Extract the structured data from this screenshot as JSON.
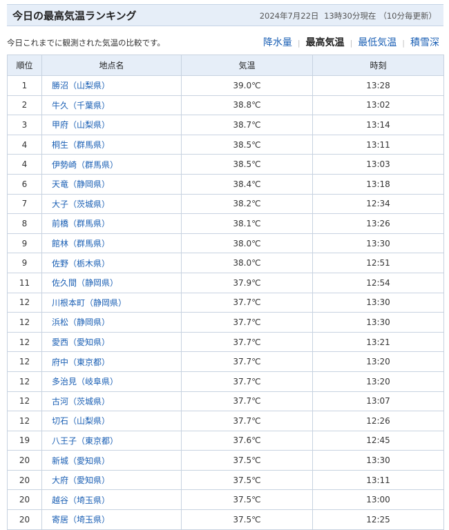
{
  "header": {
    "title": "今日の最高気温ランキング",
    "date": "2024年7月22日",
    "time": "13時30分現在",
    "update_note": "（10分毎更新）"
  },
  "description": "今日これまでに観測された気温の比較です。",
  "nav": {
    "items": [
      {
        "label": "降水量",
        "active": false
      },
      {
        "label": "最高気温",
        "active": true
      },
      {
        "label": "最低気温",
        "active": false
      },
      {
        "label": "積雪深",
        "active": false
      }
    ]
  },
  "table": {
    "headers": [
      "順位",
      "地点名",
      "気温",
      "時刻"
    ],
    "rows": [
      {
        "rank": "1",
        "location": "勝沼（山梨県）",
        "temp": "39.0℃",
        "time": "13:28"
      },
      {
        "rank": "2",
        "location": "牛久（千葉県）",
        "temp": "38.8℃",
        "time": "13:02"
      },
      {
        "rank": "3",
        "location": "甲府（山梨県）",
        "temp": "38.7℃",
        "time": "13:14"
      },
      {
        "rank": "4",
        "location": "桐生（群馬県）",
        "temp": "38.5℃",
        "time": "13:11"
      },
      {
        "rank": "4",
        "location": "伊勢崎（群馬県）",
        "temp": "38.5℃",
        "time": "13:03"
      },
      {
        "rank": "6",
        "location": "天竜（静岡県）",
        "temp": "38.4℃",
        "time": "13:18"
      },
      {
        "rank": "7",
        "location": "大子（茨城県）",
        "temp": "38.2℃",
        "time": "12:34"
      },
      {
        "rank": "8",
        "location": "前橋（群馬県）",
        "temp": "38.1℃",
        "time": "13:26"
      },
      {
        "rank": "9",
        "location": "館林（群馬県）",
        "temp": "38.0℃",
        "time": "13:30"
      },
      {
        "rank": "9",
        "location": "佐野（栃木県）",
        "temp": "38.0℃",
        "time": "12:51"
      },
      {
        "rank": "11",
        "location": "佐久間（静岡県）",
        "temp": "37.9℃",
        "time": "12:54"
      },
      {
        "rank": "12",
        "location": "川根本町（静岡県）",
        "temp": "37.7℃",
        "time": "13:30"
      },
      {
        "rank": "12",
        "location": "浜松（静岡県）",
        "temp": "37.7℃",
        "time": "13:30"
      },
      {
        "rank": "12",
        "location": "愛西（愛知県）",
        "temp": "37.7℃",
        "time": "13:21"
      },
      {
        "rank": "12",
        "location": "府中（東京都）",
        "temp": "37.7℃",
        "time": "13:20"
      },
      {
        "rank": "12",
        "location": "多治見（岐阜県）",
        "temp": "37.7℃",
        "time": "13:20"
      },
      {
        "rank": "12",
        "location": "古河（茨城県）",
        "temp": "37.7℃",
        "time": "13:07"
      },
      {
        "rank": "12",
        "location": "切石（山梨県）",
        "temp": "37.7℃",
        "time": "12:26"
      },
      {
        "rank": "19",
        "location": "八王子（東京都）",
        "temp": "37.6℃",
        "time": "12:45"
      },
      {
        "rank": "20",
        "location": "新城（愛知県）",
        "temp": "37.5℃",
        "time": "13:30"
      },
      {
        "rank": "20",
        "location": "大府（愛知県）",
        "temp": "37.5℃",
        "time": "13:11"
      },
      {
        "rank": "20",
        "location": "越谷（埼玉県）",
        "temp": "37.5℃",
        "time": "13:00"
      },
      {
        "rank": "20",
        "location": "寄居（埼玉県）",
        "temp": "37.5℃",
        "time": "12:25"
      }
    ]
  }
}
